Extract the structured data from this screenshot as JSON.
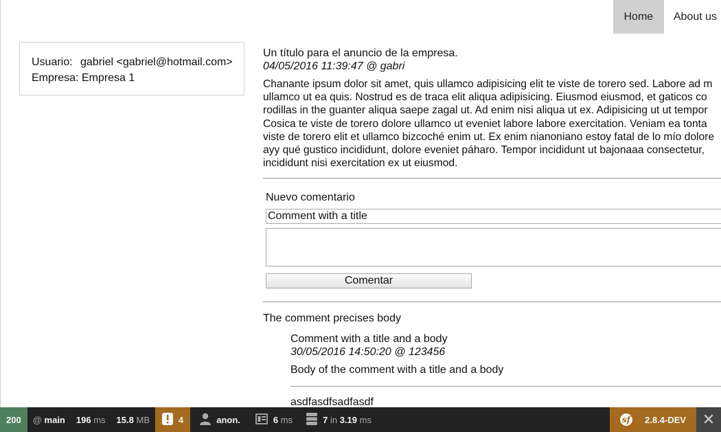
{
  "nav": {
    "items": [
      {
        "label": "Home",
        "active": true
      },
      {
        "label": "About us",
        "active": false
      }
    ]
  },
  "user_box": {
    "user_label": "Usuario:",
    "user_value": "gabriel <gabriel@hotmail.com>",
    "company_label": "Empresa:",
    "company_value": "Empresa 1"
  },
  "ad": {
    "title": "Un título para el anuncio de la empresa.",
    "meta": "04/05/2016 11:39:47 @ gabri",
    "body_lines": [
      "Chanante ipsum dolor sit amet, quis ullamco adipisicing elit te viste de torero sed. Labore ad m",
      "ullamco ut ea quis. Nostrud es de traca elit aliqua adipisicing. Eiusmod eiusmod, et gaticos co",
      "rodillas in the guanter aliqua saepe zagal ut. Ad enim nisi aliqua ut ex. Adipisicing ut ut tempor",
      "Cosica te viste de torero dolore ullamco ut eveniet labore labore exercitation. Veniam ea tonta",
      "viste de torero elit et ullamco bizcoché enim ut. Ex enim nianoniano estoy fatal de lo mío dolore",
      "ayy qué gustico incididunt, dolore eveniet páharo. Tempor incididunt ut bajonaaa consectetur,",
      "incididunt nisi exercitation ex ut eiusmod."
    ]
  },
  "comment_form": {
    "heading": "Nuevo comentario",
    "title_value": "Comment with a title",
    "body_value": "",
    "submit_label": "Comentar"
  },
  "comments_section": {
    "heading": "The comment precises body",
    "comments": [
      {
        "title": "Comment with a title and a body",
        "meta": "30/05/2016 14:50:20 @ 123456",
        "body": "Body of the comment with a title and a body"
      },
      {
        "title": "asdfasdfsadfasdf"
      }
    ]
  },
  "toolbar": {
    "status_code": "200",
    "route_prefix": "@",
    "route": "main",
    "time_value": "196",
    "time_unit": "ms",
    "memory_value": "15.8",
    "memory_unit": "MB",
    "warnings": "4",
    "user": "anon.",
    "render_time_value": "6",
    "render_time_unit": "ms",
    "queries_count": "7",
    "queries_in": "in",
    "queries_time": "3.19",
    "queries_unit": "ms",
    "version": "2.8.4-DEV",
    "logo_glyph": "sf",
    "close_glyph": "✕",
    "colors": {
      "status_bg": "#4f805d",
      "warn_bg": "#a46a1f",
      "bar_bg": "#222222"
    }
  }
}
